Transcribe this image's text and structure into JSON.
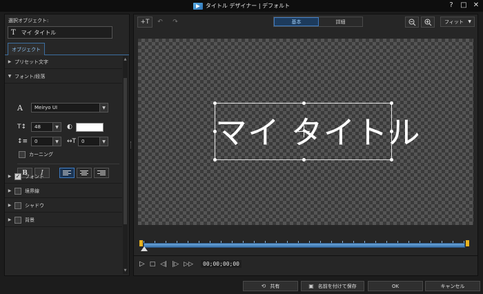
{
  "window": {
    "title": "タイトル デザイナー | デフォルト",
    "help": "?",
    "maximize": "□",
    "close": "✕"
  },
  "left": {
    "selected_label": "選択オブジェクト:",
    "selected_value": "マイ タイトル",
    "tab": "オブジェクト",
    "sections": {
      "preset": "プリセット文字",
      "font_para": "フォント/段落",
      "font": "フォント",
      "border": "境界線",
      "shadow": "シャドウ",
      "background": "背景"
    },
    "font_name": "Meiryo UI",
    "font_size": "48",
    "text_color": "#ffffff",
    "line_spacing": "0",
    "char_spacing": "0",
    "kerning": "カーニング",
    "bold": "B",
    "italic": "I",
    "font_checked": true
  },
  "right": {
    "add_text": "+T",
    "undo": "↶",
    "redo": "↷",
    "mode_basic": "基本",
    "mode_detail": "詳細",
    "zoom_out": "−",
    "zoom_in": "+",
    "fit": "フィット",
    "canvas_text": "マイ タイトル",
    "timecode": "00;00;00;00"
  },
  "footer": {
    "share": "共有",
    "save_as": "名前を付けて保存",
    "ok": "OK",
    "cancel": "キャンセル"
  }
}
